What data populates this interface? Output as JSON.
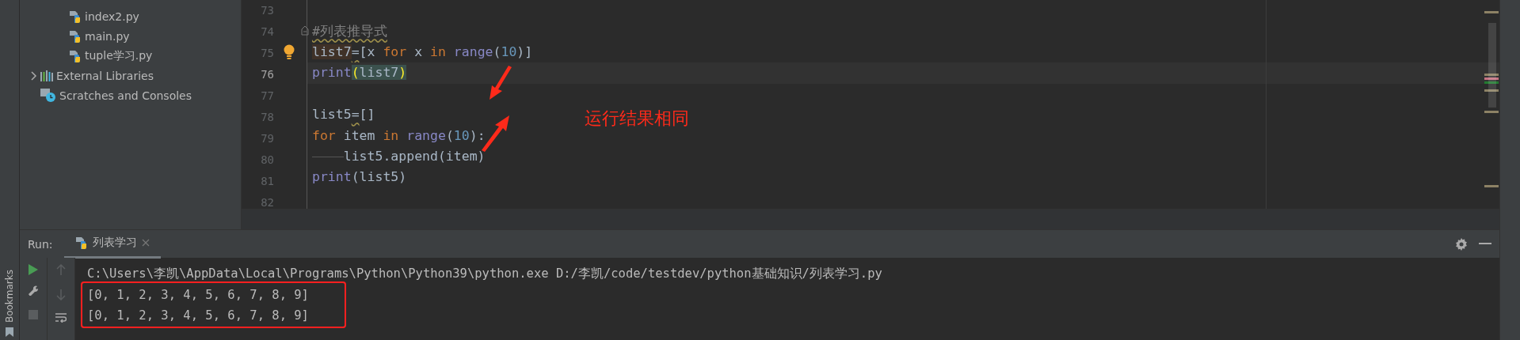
{
  "project_tree": [
    {
      "label": "index2.py",
      "kind": "python_file"
    },
    {
      "label": "main.py",
      "kind": "python_file"
    },
    {
      "label": "tuple学习.py",
      "kind": "python_file"
    },
    {
      "label": "External Libraries",
      "kind": "libraries",
      "expanded": false
    },
    {
      "label": "Scratches and Consoles",
      "kind": "scratches"
    }
  ],
  "editor": {
    "lines": [
      {
        "number": "73",
        "current": false
      },
      {
        "number": "74",
        "current": false,
        "fold_marker": true,
        "tokens": [
          {
            "text": "#列表推导式",
            "kind": "comment",
            "warn": true
          }
        ]
      },
      {
        "number": "75",
        "current": false,
        "intention_bulb": true,
        "tokens": [
          {
            "text": "list7",
            "kind": "plain",
            "highlighted": true
          },
          {
            "text": "=",
            "kind": "plain",
            "warn": true
          },
          {
            "text": "[x ",
            "kind": "plain"
          },
          {
            "text": "for",
            "kind": "keyword"
          },
          {
            "text": " x ",
            "kind": "plain"
          },
          {
            "text": "in ",
            "kind": "keyword"
          },
          {
            "text": "range",
            "kind": "builtin"
          },
          {
            "text": "(",
            "kind": "plain"
          },
          {
            "text": "10",
            "kind": "number"
          },
          {
            "text": ")]",
            "kind": "plain"
          }
        ]
      },
      {
        "number": "76",
        "current": true,
        "tokens": [
          {
            "text": "print",
            "kind": "builtin"
          },
          {
            "text": "(",
            "kind": "plain",
            "matched": true
          },
          {
            "text": "list7",
            "kind": "plain",
            "matched": true
          },
          {
            "text": ")",
            "kind": "plain",
            "matched": true
          }
        ]
      },
      {
        "number": "77",
        "current": false
      },
      {
        "number": "78",
        "current": false,
        "tokens": [
          {
            "text": "list5",
            "kind": "plain"
          },
          {
            "text": "=",
            "kind": "plain",
            "warn": true
          },
          {
            "text": "[]",
            "kind": "plain"
          }
        ]
      },
      {
        "number": "79",
        "current": false,
        "tokens": [
          {
            "text": "for",
            "kind": "keyword"
          },
          {
            "text": " item ",
            "kind": "plain"
          },
          {
            "text": "in ",
            "kind": "keyword"
          },
          {
            "text": "range",
            "kind": "builtin"
          },
          {
            "text": "(",
            "kind": "plain"
          },
          {
            "text": "10",
            "kind": "number"
          },
          {
            "text": "):",
            "kind": "plain"
          }
        ]
      },
      {
        "number": "80",
        "current": false,
        "indented": true,
        "tokens": [
          {
            "text": "list5.append(item)",
            "kind": "plain"
          }
        ]
      },
      {
        "number": "81",
        "current": false,
        "tokens": [
          {
            "text": "print",
            "kind": "builtin"
          },
          {
            "text": "(list5)",
            "kind": "plain"
          }
        ]
      },
      {
        "number": "82",
        "current": false
      }
    ]
  },
  "annotation": {
    "text": "运行结果相同"
  },
  "run_panel": {
    "title": "Run:",
    "tabs": [
      {
        "label": "列表学习",
        "selected": true
      }
    ],
    "console_lines": [
      {
        "text": "C:\\Users\\李凯\\AppData\\Local\\Programs\\Python\\Python39\\python.exe D:/李凯/code/testdev/python基础知识/列表学习.py",
        "boxed": false
      },
      {
        "text": "[0, 1, 2, 3, 4, 5, 6, 7, 8, 9]",
        "boxed": true
      },
      {
        "text": "[0, 1, 2, 3, 4, 5, 6, 7, 8, 9]",
        "boxed": true
      }
    ]
  },
  "bookmarks_label": "Bookmarks"
}
